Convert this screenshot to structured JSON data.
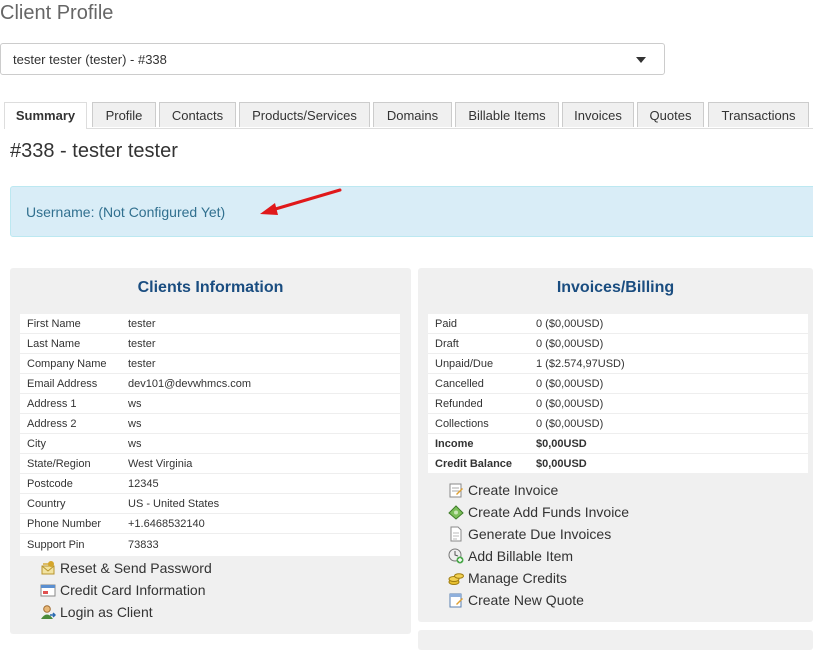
{
  "page": {
    "title": "Client Profile"
  },
  "client_select": {
    "value": "tester tester (tester) - #338"
  },
  "tabs": [
    {
      "label": "Summary",
      "active": true
    },
    {
      "label": "Profile"
    },
    {
      "label": "Contacts"
    },
    {
      "label": "Products/Services"
    },
    {
      "label": "Domains"
    },
    {
      "label": "Billable Items"
    },
    {
      "label": "Invoices"
    },
    {
      "label": "Quotes"
    },
    {
      "label": "Transactions"
    }
  ],
  "client_heading": "#338 - tester tester",
  "alert": {
    "text": "Username: (Not Configured Yet)",
    "arrow_color": "#e0191b"
  },
  "clients_info": {
    "title": "Clients Information",
    "rows": [
      {
        "label": "First Name",
        "value": "tester"
      },
      {
        "label": "Last Name",
        "value": "tester"
      },
      {
        "label": "Company Name",
        "value": "tester"
      },
      {
        "label": "Email Address",
        "value": "dev101@devwhmcs.com"
      },
      {
        "label": "Address 1",
        "value": "ws"
      },
      {
        "label": "Address 2",
        "value": "ws"
      },
      {
        "label": "City",
        "value": "ws"
      },
      {
        "label": "State/Region",
        "value": "West Virginia"
      },
      {
        "label": "Postcode",
        "value": "12345"
      },
      {
        "label": "Country",
        "value": "US - United States"
      },
      {
        "label": "Phone Number",
        "value": "+1.6468532140"
      },
      {
        "label": "Support Pin",
        "value": "73833"
      }
    ],
    "links": [
      {
        "label": "Reset & Send Password",
        "icon": "key-envelope-icon"
      },
      {
        "label": "Credit Card Information",
        "icon": "credit-card-icon"
      },
      {
        "label": "Login as Client",
        "icon": "user-login-icon"
      }
    ]
  },
  "billing": {
    "title": "Invoices/Billing",
    "rows": [
      {
        "label": "Paid",
        "value": "0 ($0,00USD)"
      },
      {
        "label": "Draft",
        "value": "0 ($0,00USD)"
      },
      {
        "label": "Unpaid/Due",
        "value": "1 ($2.574,97USD)"
      },
      {
        "label": "Cancelled",
        "value": "0 ($0,00USD)"
      },
      {
        "label": "Refunded",
        "value": "0 ($0,00USD)"
      },
      {
        "label": "Collections",
        "value": "0 ($0,00USD)"
      },
      {
        "label": "Income",
        "value": "$0,00USD"
      },
      {
        "label": "Credit Balance",
        "value": "$0,00USD"
      }
    ],
    "links": [
      {
        "label": "Create Invoice",
        "icon": "invoice-icon"
      },
      {
        "label": "Create Add Funds Invoice",
        "icon": "money-icon"
      },
      {
        "label": "Generate Due Invoices",
        "icon": "document-icon"
      },
      {
        "label": "Add Billable Item",
        "icon": "clock-add-icon"
      },
      {
        "label": "Manage Credits",
        "icon": "coins-icon"
      },
      {
        "label": "Create New Quote",
        "icon": "quote-icon"
      }
    ]
  }
}
